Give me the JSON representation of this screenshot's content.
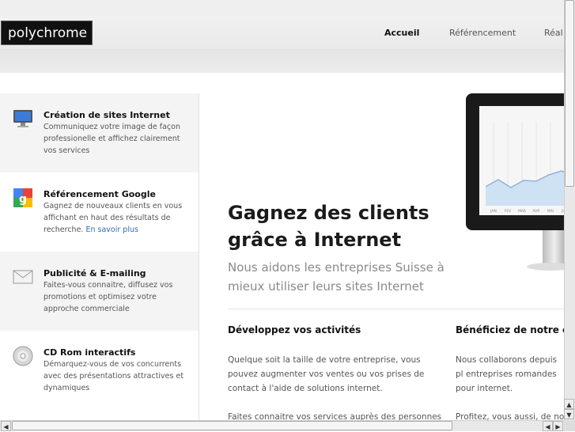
{
  "header": {
    "logo": "polychrome",
    "nav": [
      {
        "label": "Accueil",
        "active": true
      },
      {
        "label": "Référencement",
        "active": false
      },
      {
        "label": "Réal",
        "active": false
      }
    ]
  },
  "services": [
    {
      "icon": "monitor-icon",
      "title": "Création de sites Internet",
      "desc": "Communiquez votre image de façon professionelle et affichez clairement vos services"
    },
    {
      "icon": "google-icon",
      "title": "Référencement Google",
      "desc": "Gagnez de nouveaux clients en vous affichant en haut des résultats de recherche.",
      "link": "En savoir plus"
    },
    {
      "icon": "envelope-icon",
      "title": "Publicité & E-mailing",
      "desc": "Faites-vous connaitre, diffusez vos promotions et optimisez votre approche commerciale"
    },
    {
      "icon": "cd-icon",
      "title": "CD Rom interactifs",
      "desc": "Démarquez-vous de vos concurrents avec des présentations attractives et dynamiques"
    }
  ],
  "hero": {
    "title": "Gagnez des clients grâce à Internet",
    "subtitle": "Nous aidons les entreprises Suisse à mieux utiliser leurs sites Internet"
  },
  "columns": [
    {
      "title": "Développez vos activités",
      "text": "Quelque soit la taille de votre entreprise, vous pouvez augmenter vos ventes ou vos prises de contact à l'aide de solutions internet.",
      "text2": "Faites connaitre vos services auprès des personnes"
    },
    {
      "title": "Bénéficiez de notre ex",
      "text": "Nous collaborons depuis pl entreprises romandes pour internet.",
      "text2": "Profitez, vous aussi, de notr"
    }
  ],
  "monitor_chart": {
    "months": [
      "JAN",
      "FEV",
      "MAR",
      "AVR",
      "MAI",
      "JUN"
    ]
  },
  "colors": {
    "link": "#2a6fb5",
    "logo_bg": "#111111",
    "chart_fill": "#cfe2f4",
    "chart_line": "#8fb3d9"
  }
}
